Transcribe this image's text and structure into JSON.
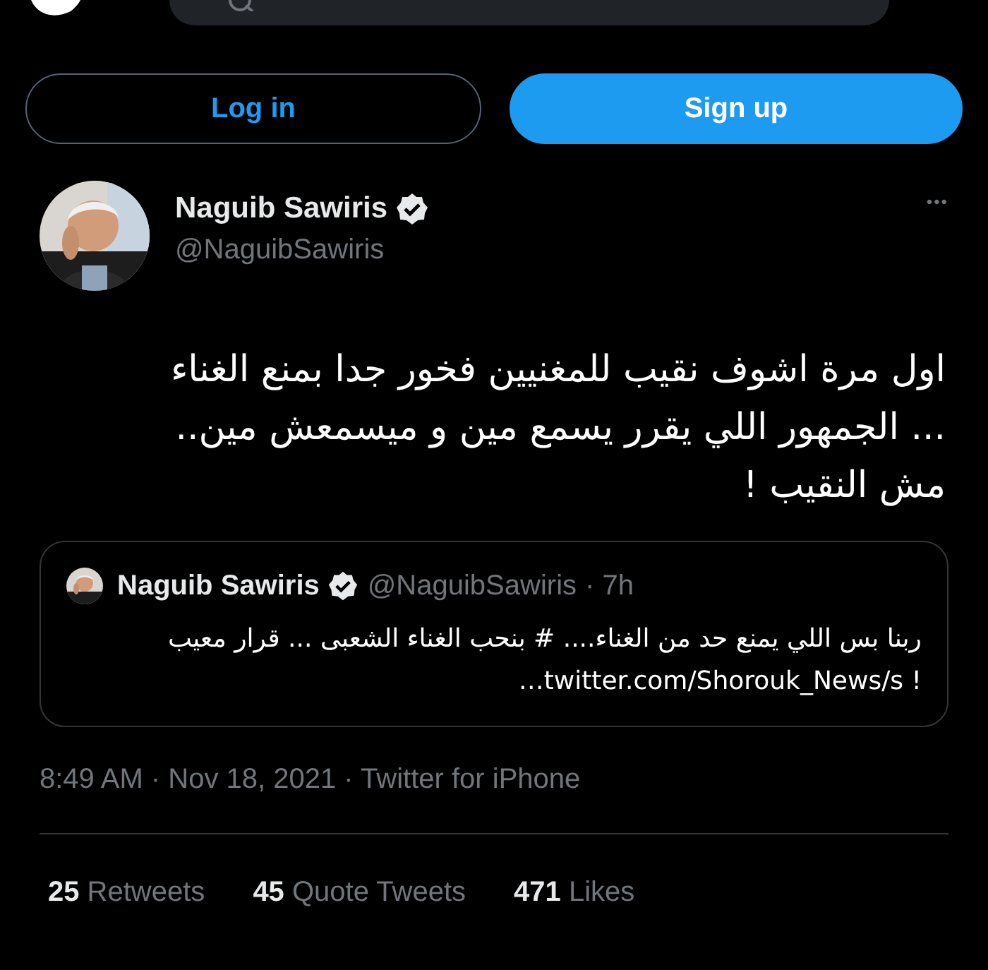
{
  "header": {
    "search": {
      "kind": "search"
    }
  },
  "auth_buttons": [
    {
      "label": "Log in",
      "kind": "outline"
    },
    {
      "label": "Sign up",
      "kind": "filled"
    }
  ],
  "tweet": {
    "author": {
      "name": "Naguib Sawiris",
      "verified": true,
      "handle": "@NaguibSawiris"
    },
    "more": "•••",
    "text_lines": [
      "اول مرة اشوف نقيب للمغنيين فخور جدا بمنع الغناء",
      "... الجمهور اللي يقرر يسمع مين و ميسمعش مين..",
      "مش النقيب !"
    ],
    "quote": {
      "name": "Naguib Sawiris",
      "verified": true,
      "handle": "@NaguibSawiris",
      "time": "· 7h",
      "text_lines": [
        "ربنا بس اللي يمنع حد من الغناء.... # بنحب الغناء الشعبى ... قرار معيب",
        "…twitter.com/Shorouk_News/s !"
      ]
    },
    "timestamp": "8:49 AM · Nov 18, 2021 · Twitter for iPhone",
    "stats": [
      {
        "count": "25",
        "label": "Retweets"
      },
      {
        "count": "45",
        "label": "Quote Tweets"
      },
      {
        "count": "471",
        "label": "Likes"
      }
    ]
  }
}
